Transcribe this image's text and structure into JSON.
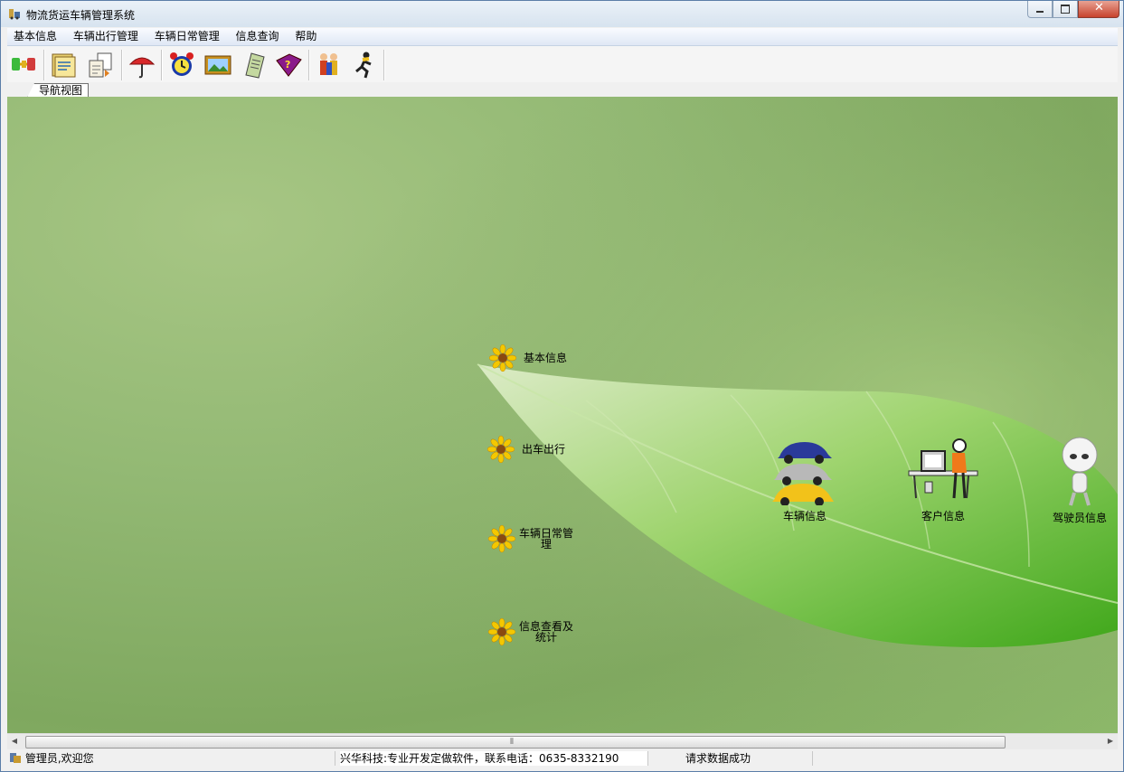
{
  "window": {
    "title": "物流货运车辆管理系统"
  },
  "menu": [
    "基本信息",
    "车辆出行管理",
    "车辆日常管理",
    "信息查询",
    "帮助"
  ],
  "toolbar": [
    {
      "name": "connect-icon"
    },
    {
      "name": "folder-icon"
    },
    {
      "name": "documents-icon"
    },
    {
      "name": "umbrella-icon"
    },
    {
      "name": "alarm-clock-icon"
    },
    {
      "name": "picture-icon"
    },
    {
      "name": "notepad-icon"
    },
    {
      "name": "help-book-icon"
    },
    {
      "name": "users-icon"
    },
    {
      "name": "exit-runner-icon"
    }
  ],
  "tab": {
    "label": "导航视图"
  },
  "nav": {
    "basic_info": "基本信息",
    "dispatch": "出车出行",
    "daily_line1": "车辆日常管",
    "daily_line2": "理",
    "query_line1": "信息查看及",
    "query_line2": "统计"
  },
  "hotspots": {
    "vehicle": "车辆信息",
    "customer": "客户信息",
    "driver": "驾驶员信息"
  },
  "status": {
    "user": "管理员,欢迎您",
    "company": "兴华科技:专业开发定做软件，联系电话：0635-8332190",
    "message": "请求数据成功"
  },
  "colors": {
    "accent": "#4a8a2a",
    "leaf": "#7cc850",
    "close": "#c7432d"
  }
}
